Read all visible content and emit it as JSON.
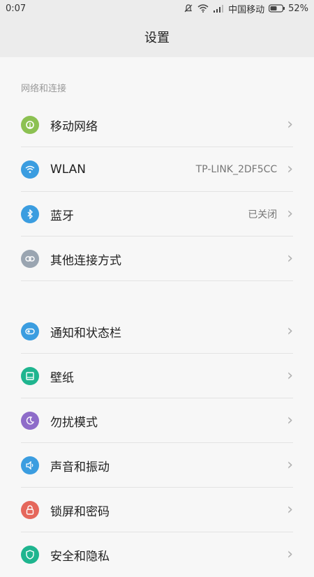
{
  "status": {
    "time": "0:07",
    "carrier": "中国移动",
    "battery": "52%"
  },
  "header": {
    "title": "设置"
  },
  "sections": {
    "network_label": "网络和连接"
  },
  "rows": {
    "mobile": {
      "label": "移动网络",
      "icon": "cellular-icon",
      "color": "#8cc152"
    },
    "wlan": {
      "label": "WLAN",
      "value": "TP-LINK_2DF5CC",
      "icon": "wifi-icon",
      "color": "#3b9de0"
    },
    "bluetooth": {
      "label": "蓝牙",
      "value": "已关闭",
      "icon": "bluetooth-icon",
      "color": "#3b9de0"
    },
    "other": {
      "label": "其他连接方式",
      "icon": "link-icon",
      "color": "#9aa5b1"
    },
    "notify": {
      "label": "通知和状态栏",
      "icon": "toggle-icon",
      "color": "#3b9de0"
    },
    "wallpaper": {
      "label": "壁纸",
      "icon": "wallpaper-icon",
      "color": "#1fb58f"
    },
    "dnd": {
      "label": "勿扰模式",
      "icon": "moon-icon",
      "color": "#8e6cc9"
    },
    "sound": {
      "label": "声音和振动",
      "icon": "speaker-icon",
      "color": "#3b9de0"
    },
    "lock": {
      "label": "锁屏和密码",
      "icon": "lock-icon",
      "color": "#e5675b"
    },
    "privacy": {
      "label": "安全和隐私",
      "icon": "shield-icon",
      "color": "#1fb58f"
    }
  }
}
